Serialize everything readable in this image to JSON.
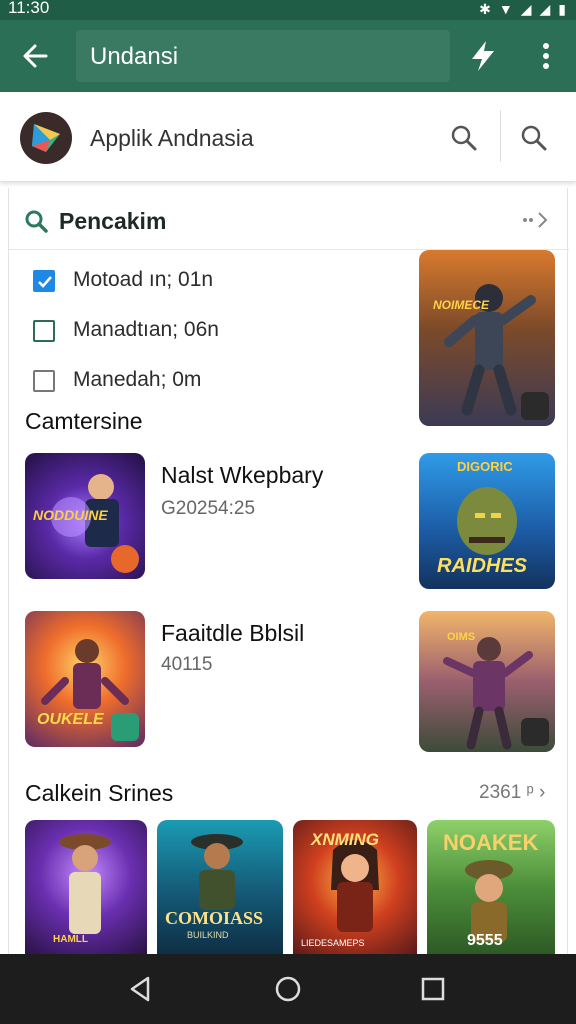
{
  "status": {
    "time": "11:30"
  },
  "appbar": {
    "title": "Undansi"
  },
  "header": {
    "app_name": "Applik Andnasia"
  },
  "section": {
    "title": "Pencakim"
  },
  "filters": [
    {
      "label": "Motoad ın; 01n",
      "state": "checked"
    },
    {
      "label": "Manadtıan; 06n",
      "state": "outlined"
    },
    {
      "label": "Manedah; 0m",
      "state": "plain"
    }
  ],
  "category1": {
    "title": "Camtersine",
    "items": [
      {
        "title": "Nalst Wkepbary",
        "subtitle": "G20254:25",
        "thumb_text": "NODDUINE"
      },
      {
        "title": "Faaitdle Bblsil",
        "subtitle": "40115",
        "thumb_text": "OUKELE"
      }
    ]
  },
  "side_thumbs": [
    {
      "text": "NOIMECE"
    },
    {
      "text": "DIGORIC",
      "caption": "RAIDHES"
    },
    {
      "text": "OIMS"
    }
  ],
  "category2": {
    "title": "Calkein Srines",
    "more_label": "2361 ᵖ",
    "cards": [
      {
        "text": "HAMLL"
      },
      {
        "text": "COMOIASS",
        "sub": "BUILKIND"
      },
      {
        "text": "XNMING",
        "sub": "LIEDESAMEPS"
      },
      {
        "text": "NOAKEK",
        "sub": "9555"
      }
    ]
  }
}
